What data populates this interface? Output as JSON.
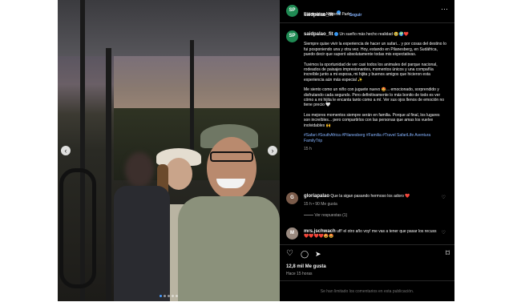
{
  "header": {
    "username": "saidpalao_fit",
    "follow_label": "Seguir",
    "location": "Pilanesberg National Park",
    "separator": "•"
  },
  "caption": {
    "username": "saidpalao_fit",
    "title": "Un sueño más hecho realidad 🥹🌍❤️",
    "paragraphs": [
      "Siempre quise vivir la experiencia de hacer un safari... y por cosas del destino lo fui posponiendo una y otra vez. Hoy, estando en Pilanesberg, en Sudáfrica, puedo decir que superó absolutamente todas mis expectativas.",
      "Tuvimos la oportunidad de ver casi todos los animales del parque nacional, rodeados de paisajes impresionantes, momentos únicos y una compañía increíble junto a mi esposa, mi hijita y buenos amigos que hicieron esta experiencia aún más especial ✨",
      "Me siento como un niño con juguete nuevo 🤩... emocionado, sorprendido y disfrutando cada segundo. Pero definitivamente lo más bonito de todo es ver cómo a mi hijita le encanta tanto como a mí. Ver sus ojos llenos de emoción no tiene precio 🤍",
      "Los mejores momentos siempre serán en familia. Porque al final, los lugares son increíbles... pero compartirlos con las personas que amas los vuelve inolvidables 🙌"
    ],
    "hashtags": "#Safari #SouthAfrica #Pilanesberg #Familia #Travel SafariLife Aventura FamilyTrip",
    "age": "15 h"
  },
  "comments": [
    {
      "username": "gloriapalao",
      "text": "Que la sigan pasando hermoso los adoro ❤️",
      "age": "15 h",
      "likes": "90 Me gusta",
      "replies_label": "Ver respuestas (1)"
    },
    {
      "username": "mrs.jschwach",
      "text": "uff! el otro año voy! me vas a tener que pasar los recuss ❤️❤️❤️❤️🤩🤩"
    }
  ],
  "stats": {
    "likes": "12,8 mil Me gusta",
    "time": "Hace 15 horas"
  },
  "footer": {
    "notice": "Se han limitado los comentarios en esta publicación."
  },
  "icons": {
    "like": "♡",
    "comment": "◯",
    "share": "➤",
    "save": "⌑",
    "more": "⋯",
    "prev": "‹",
    "next": "›"
  },
  "colors": {
    "accent": "#85b3ff",
    "verified": "#3897f0",
    "background": "#000000"
  }
}
